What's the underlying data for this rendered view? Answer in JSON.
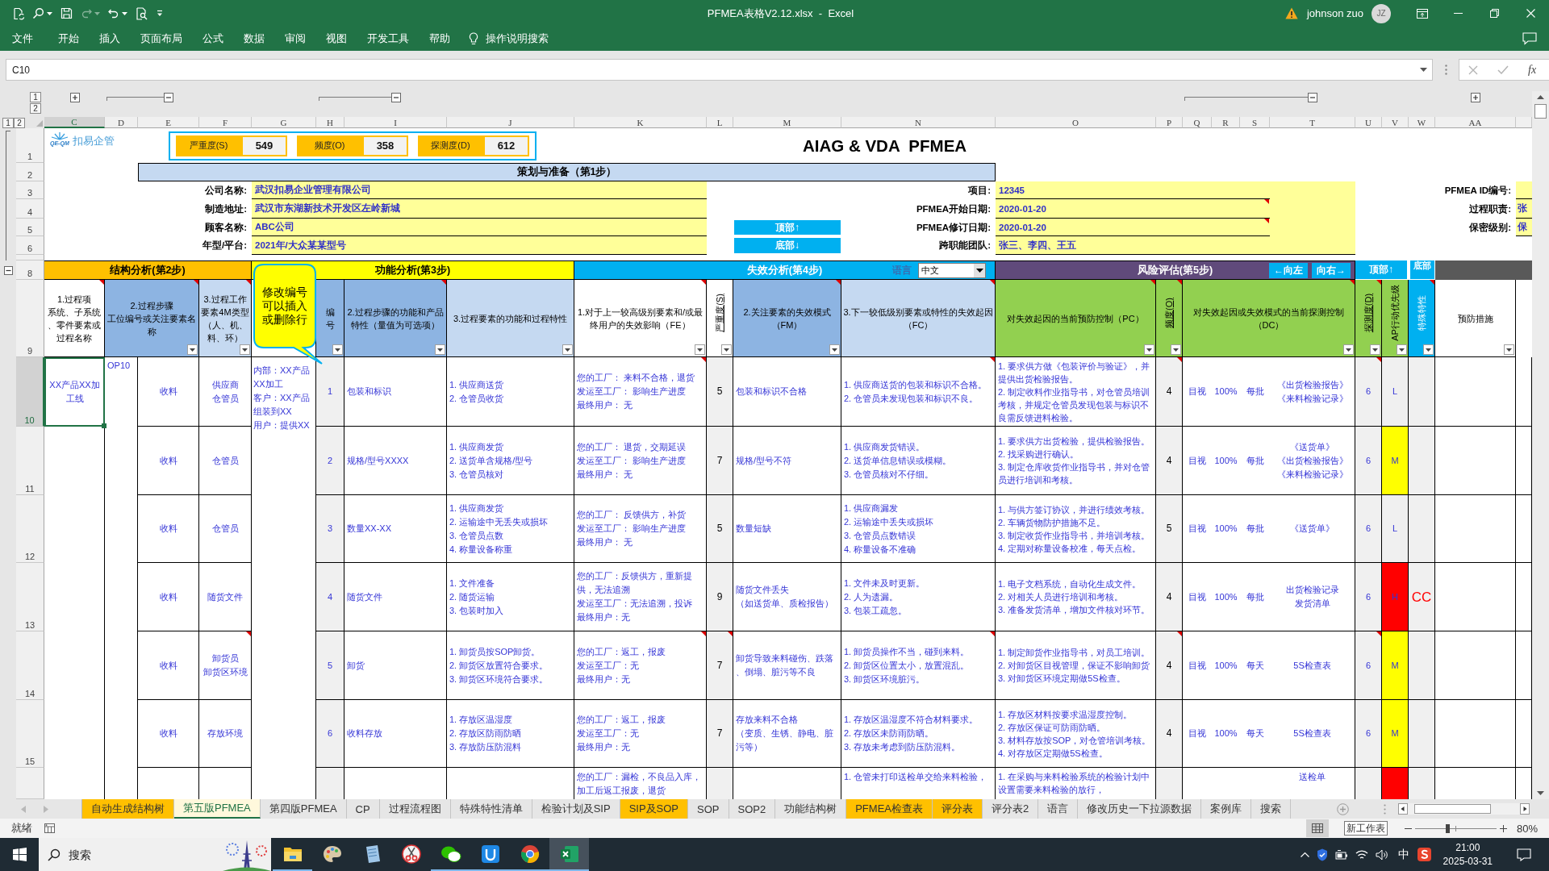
{
  "title_bar": {
    "title": "PFMEA表格V2.12.xlsx  -  Excel",
    "user": "johnson zuo",
    "avatar": "JZ"
  },
  "menu": {
    "items": [
      "文件",
      "开始",
      "插入",
      "页面布局",
      "公式",
      "数据",
      "审阅",
      "视图",
      "开发工具",
      "帮助"
    ],
    "tell_me": "操作说明搜索"
  },
  "formula_bar": {
    "name_box": "C10",
    "function_label": "fx"
  },
  "outline": {
    "column_levels": [
      "1",
      "2"
    ],
    "row_levels": [
      "1",
      "2"
    ]
  },
  "column_headers": [
    {
      "label": "C",
      "selected": true
    },
    {
      "label": "D",
      "selected": false
    },
    {
      "label": "E",
      "selected": false
    },
    {
      "label": "F",
      "selected": false
    },
    {
      "label": "G",
      "selected": false
    },
    {
      "label": "H",
      "selected": false
    },
    {
      "label": "I",
      "selected": false
    },
    {
      "label": "J",
      "selected": false
    },
    {
      "label": "K",
      "selected": false
    },
    {
      "label": "L",
      "selected": false
    },
    {
      "label": "M",
      "selected": false
    },
    {
      "label": "N",
      "selected": false
    },
    {
      "label": "O",
      "selected": false
    },
    {
      "label": "P",
      "selected": false
    },
    {
      "label": "Q",
      "selected": false
    },
    {
      "label": "R",
      "selected": false
    },
    {
      "label": "S",
      "selected": false
    },
    {
      "label": "T",
      "selected": false
    },
    {
      "label": "U",
      "selected": false
    },
    {
      "label": "V",
      "selected": false
    },
    {
      "label": "W",
      "selected": false
    },
    {
      "label": "AA",
      "selected": false
    }
  ],
  "row_headers": [
    {
      "label": "1",
      "selected": false
    },
    {
      "label": "2",
      "selected": false
    },
    {
      "label": "3",
      "selected": false
    },
    {
      "label": "4",
      "selected": false
    },
    {
      "label": "5",
      "selected": false
    },
    {
      "label": "6",
      "selected": false
    },
    {
      "label": "8",
      "selected": false
    },
    {
      "label": "9",
      "selected": false
    },
    {
      "label": "10",
      "selected": true
    },
    {
      "label": "11",
      "selected": false
    },
    {
      "label": "12",
      "selected": false
    },
    {
      "label": "13",
      "selected": false
    },
    {
      "label": "14",
      "selected": false
    },
    {
      "label": "15",
      "selected": false
    }
  ],
  "sheet": {
    "logo": {
      "subtext": "QE-QM",
      "text": "扣易企管"
    },
    "scores": [
      {
        "label": "严重度(S)",
        "value": "549"
      },
      {
        "label": "频度(O)",
        "value": "358"
      },
      {
        "label": "探测度(D)",
        "value": "612"
      }
    ],
    "title": "AIAG & VDA  PFMEA",
    "planning_title": "策划与准备（第1步）",
    "left_fields": [
      {
        "label": "公司名称:",
        "value": "武汉扣易企业管理有限公司"
      },
      {
        "label": "制造地址:",
        "value": "武汉市东湖新技术开发区左岭新城"
      },
      {
        "label": "顾客名称:",
        "value": "ABC公司"
      },
      {
        "label": "年型/平台:",
        "value": "2021年/大众某某型号"
      }
    ],
    "jump_buttons": [
      "顶部↑",
      "底部↓"
    ],
    "right_fields": [
      {
        "label": "项目:",
        "value": "12345",
        "comment": false
      },
      {
        "label": "PFMEA开始日期:",
        "value": "2020-01-20",
        "comment": true
      },
      {
        "label": "PFMEA修订日期:",
        "value": "2020-01-20",
        "comment": true
      },
      {
        "label": "跨职能团队:",
        "value": "张三、李四、王五",
        "comment": false
      }
    ],
    "far_right_fields": [
      {
        "label": "PFMEA ID编号:"
      },
      {
        "label": "过程职责:",
        "value": "张"
      },
      {
        "label": "保密级别:",
        "value": "保"
      }
    ],
    "sections": [
      {
        "title": "结构分析(第2步)",
        "color": "#ffc000"
      },
      {
        "title": "功能分析(第3步)",
        "color": "#ffff00"
      },
      {
        "title": "失效分析(第4步)",
        "color": "#00b0f0"
      },
      {
        "title": "风险评估(第5步)",
        "color": "#604a7b"
      }
    ],
    "language": {
      "label": "语言",
      "value": "中文"
    },
    "nav_buttons": [
      "←向左",
      "向右→",
      "顶部↑",
      "底部"
    ],
    "callout": "修改编号可以插入或删除行",
    "headers": [
      {
        "lines": [
          "1.过程项",
          "系统、子系统",
          "、零件要素或",
          "过程名称"
        ],
        "kind": "horizontal",
        "color": "#ffffff",
        "filter": false,
        "comment": true
      },
      {
        "lines": [
          "2.过程步骤",
          "工位编号或关注要素名",
          "称"
        ],
        "kind": "horizontal",
        "color": "#8db4e2",
        "filter": true,
        "comment": true
      },
      {
        "lines": [
          "3.过程工作",
          "要素4M类型",
          "（人、机、",
          "料、环）"
        ],
        "kind": "horizontal",
        "color": "#c5d9f1",
        "filter": true,
        "comment": true
      },
      {
        "lines": [
          "编",
          "号"
        ],
        "kind": "horizontal",
        "color": "#8db4e2",
        "filter": true,
        "comment": false
      },
      {
        "lines": [
          "2.过程步骤的功能和产品",
          "特性（量值为可选项）"
        ],
        "kind": "horizontal",
        "color": "#8db4e2",
        "filter": true,
        "comment": true
      },
      {
        "lines": [
          "3.过程要素的功能和过程特性"
        ],
        "kind": "horizontal",
        "color": "#c5d9f1",
        "filter": true,
        "comment": false
      },
      {
        "lines": [
          "1.对于上一较高级别要素和/或最",
          "终用户的失效影响（FE）"
        ],
        "kind": "horizontal",
        "color": "#ffffff",
        "filter": true,
        "comment": true
      },
      {
        "lines": [
          "严重度(S)"
        ],
        "kind": "vertical",
        "underline": true,
        "color": "#ffffff",
        "filter": true,
        "comment": false
      },
      {
        "lines": [
          "2.关注要素的失效模式",
          "（FM）"
        ],
        "kind": "horizontal",
        "color": "#8db4e2",
        "filter": true,
        "comment": true
      },
      {
        "lines": [
          "3.下一较低级别要素或特性的失效起因",
          "（FC）"
        ],
        "kind": "horizontal",
        "color": "#c5d9f1",
        "filter": false,
        "comment": true
      },
      {
        "lines": [
          "对失效起因的当前预防控制（PC）"
        ],
        "kind": "horizontal",
        "color": "#92d050",
        "filter": true,
        "comment": true
      },
      {
        "lines": [
          "频度(O)"
        ],
        "kind": "vertical",
        "underline": true,
        "color": "#92d050",
        "filter": true,
        "comment": true
      },
      {
        "lines": [
          "对失效起因或失效模式的当前探测控制",
          "（DC）"
        ],
        "kind": "horizontal",
        "color": "#92d050",
        "filter": true,
        "comment": true
      },
      {
        "lines": [
          "探测度(D)"
        ],
        "kind": "vertical",
        "underline": true,
        "color": "#92d050",
        "filter": true,
        "comment": true
      },
      {
        "lines": [
          "AP行动优先级"
        ],
        "kind": "vertical",
        "underline": false,
        "color": "#92d050",
        "filter": true,
        "comment": false
      },
      {
        "lines": [
          "特殊特性"
        ],
        "kind": "vertical",
        "underline": false,
        "color": "#00b0f0",
        "filter": true,
        "comment": true
      },
      {
        "lines": [
          "预防措施"
        ],
        "kind": "horizontal",
        "color": "#ffffff",
        "filter": true,
        "comment": false
      }
    ],
    "structure": {
      "item": "XX产品XX加工线",
      "selected": true,
      "step": "OP10",
      "notes": [
        "内部：XX产品XX加工",
        "客户：XX产品组装到XX",
        "用户：提供XX"
      ]
    },
    "rows": [
      {
        "kind": "full",
        "process": "收料",
        "element": [
          "供应商",
          "仓管员"
        ],
        "no": "1",
        "function": "包装和标识",
        "characteristics": [
          "1. 供应商送货",
          "2. 仓管员收货"
        ],
        "effects": [
          "您的工厂： 来料不合格，退货",
          "发运至工厂： 影响生产进度",
          "最终用户： 无"
        ],
        "severity": "5",
        "failure_mode": [
          "包装和标识不合格"
        ],
        "causes": [
          "1. 供应商送货的包装和标识不合格。",
          "2. 仓管员未发现包装和标识不良。"
        ],
        "prevention": [
          "1. 要求供方做《包装评价与验证》，并提供出货检验报告。",
          "2. 制定收料作业指导书，对仓管员培训考核，并规定仓管员发现包装与标识不良需反馈进料检验。"
        ],
        "occurrence": "4",
        "method": "目视",
        "sample": "100%",
        "frequency": "每批",
        "controls": [
          "《出货检验报告》",
          "《来料检验记录》"
        ],
        "detection": "6",
        "ap": {
          "text": "L",
          "color": "#f0f0f0"
        },
        "comment_on": {
          "effects": true,
          "causes": true,
          "occurrence": true,
          "detection": true
        }
      },
      {
        "kind": "full",
        "process": "收料",
        "element": [
          "仓管员"
        ],
        "no": "2",
        "function": "规格/型号XXXX",
        "characteristics": [
          "1. 供应商发货",
          "2. 送货单含规格/型号",
          "3. 仓管员核对"
        ],
        "effects": [
          "您的工厂： 退货，交期延误",
          "发运至工厂： 影响生产进度",
          "最终用户： 无"
        ],
        "severity": "7",
        "failure_mode": [
          "规格/型号不符"
        ],
        "causes": [
          "1. 供应商发货错误。",
          "2. 送货单信息错误或模糊。",
          "3. 仓管员核对不仔细。"
        ],
        "prevention": [
          "1. 要求供方出货检验，提供检验报告。",
          "2. 找采购进行确认。",
          "3. 制定仓库收货作业指导书，并对仓管员进行培训和考核。"
        ],
        "occurrence": "4",
        "method": "目视",
        "sample": "100%",
        "frequency": "每批",
        "controls": [
          "《送货单》",
          "《出货检验报告》",
          "《来料检验记录》"
        ],
        "detection": "6",
        "ap": {
          "text": "M",
          "color": "#ffff00"
        }
      },
      {
        "kind": "full",
        "process": "收料",
        "element": [
          "仓管员"
        ],
        "no": "3",
        "function": "数量XX-XX",
        "characteristics": [
          "1. 供应商发货",
          "2. 运输途中无丢失或损坏",
          "3. 仓管员点数",
          "4. 称量设备称重"
        ],
        "effects": [
          "您的工厂： 反馈供方，补货",
          "发运至工厂： 影响生产进度",
          "最终用户： 无"
        ],
        "severity": "5",
        "failure_mode": [
          "数量短缺"
        ],
        "causes": [
          "1. 供应商漏发",
          "2. 运输途中丢失或损坏",
          "3. 仓管员点数错误",
          "4. 称量设备不准确"
        ],
        "prevention": [
          "1. 与供方签订协议，并进行绩效考核。",
          "2. 车辆货物防护措施不足。",
          "3. 制定收货作业指导书，并培训考核。",
          "4. 定期对称量设备校准，每天点检。"
        ],
        "occurrence": "5",
        "method": "目视",
        "sample": "100%",
        "frequency": "每批",
        "controls": [
          "《送货单》"
        ],
        "detection": "6",
        "ap": {
          "text": "L",
          "color": "#f0f0f0"
        }
      },
      {
        "kind": "full",
        "process": "收料",
        "element": [
          "随货文件"
        ],
        "no": "4",
        "function": "随货文件",
        "characteristics": [
          "1. 文件准备",
          "2. 随货运输",
          "3. 包装时加入"
        ],
        "effects": [
          "您的工厂：反馈供方，重新提供，无法追溯",
          "发运至工厂：无法追溯，投诉",
          "最终用户：无"
        ],
        "severity": "9",
        "failure_mode": [
          "随货文件丢失",
          "（如送货单、质检报告）"
        ],
        "causes": [
          "1. 文件未及时更新。",
          "2. 人为遗漏。",
          "3. 包装工疏忽。"
        ],
        "prevention": [
          "1. 电子文档系统，自动化生成文件。",
          "2. 对相关人员进行培训和考核。",
          "3. 准备发货清单，增加文件核对环节。"
        ],
        "occurrence": "4",
        "method": "目视",
        "sample": "100%",
        "frequency": "每批",
        "controls": [
          "出货检验记录",
          "发货清单"
        ],
        "detection": "6",
        "ap": {
          "text": "H",
          "color": "#ff0000"
        },
        "special": "CC"
      },
      {
        "kind": "full",
        "process": "收料",
        "element": [
          "卸货员",
          "卸货区环境"
        ],
        "no": "5",
        "function": "卸货",
        "characteristics": [
          "1. 卸货员按SOP卸货。",
          "2. 卸货区放置符合要求。",
          "3. 卸货区环境符合要求。"
        ],
        "effects": [
          "您的工厂：返工，报废",
          "发运至工厂：无",
          "最终用户：无"
        ],
        "severity": "7",
        "failure_mode": [
          "卸货导致来料碰伤、跌落、倒塌、脏污等不良"
        ],
        "causes": [
          "1. 卸货员操作不当，碰到来料。",
          "2. 卸货区位置太小，放置混乱。",
          "3. 卸货区环境脏污。"
        ],
        "prevention": [
          "1. 制定卸货作业指导书，对员工培训。",
          "2. 对卸货区目视管理，保证不影响卸货",
          "3. 对卸货区环境定期做5S检查。"
        ],
        "occurrence": "4",
        "method": "目视",
        "sample": "100%",
        "frequency": "每天",
        "controls": [
          "5S检查表"
        ],
        "detection": "6",
        "ap": {
          "text": "M",
          "color": "#ffff00"
        },
        "comment_on": {
          "element": true,
          "effects": true,
          "severity": true,
          "causes": true,
          "occurrence": true,
          "detection": true
        }
      },
      {
        "kind": "full",
        "process": "收料",
        "element": [
          "存放环境"
        ],
        "no": "6",
        "function": "收料存放",
        "characteristics": [
          "1. 存放区温湿度",
          "2. 存放区防雨防晒",
          "3. 存放防压防混料"
        ],
        "effects": [
          "您的工厂：返工，报废",
          "发运至工厂：无",
          "最终用户：无"
        ],
        "severity": "7",
        "failure_mode": [
          "存放来料不合格",
          "（变质、生锈、静电、脏污等）"
        ],
        "causes": [
          "1. 存放区温湿度不符合材料要求。",
          "2. 存放区未防雨防晒。",
          "3. 存放未考虑到防压防混料。"
        ],
        "prevention": [
          "1. 存放区材料按要求温湿度控制。",
          "2. 存放区保证可防雨防晒。",
          "3. 材料存放按SOP，对仓管培训考核。",
          "4. 对存放区定期做5S检查。"
        ],
        "occurrence": "4",
        "method": "目视",
        "sample": "100%",
        "frequency": "每天",
        "controls": [
          "5S检查表"
        ],
        "detection": "6",
        "ap": {
          "text": "M",
          "color": "#ffff00"
        }
      },
      {
        "kind": "partial",
        "effects": [
          "您的工厂：漏检，不良品入库，",
          "加工后返工报废，退货"
        ],
        "causes": [
          "1. 仓管未打印送检单交给来料检验，"
        ],
        "prevention": [
          "1. 在采购与来料检验系统的检验计划中设置需要来料检验的放行，"
        ],
        "controls": [
          "送检单"
        ],
        "ap": {
          "color": "#ff0000"
        }
      }
    ]
  },
  "sheet_tabs": [
    {
      "label": "自动生成结构树",
      "selected": false,
      "color": "#ffc000"
    },
    {
      "label": "第五版PFMEA",
      "selected": true
    },
    {
      "label": "第四版PFMEA",
      "selected": false
    },
    {
      "label": "CP",
      "selected": false
    },
    {
      "label": "过程流程图",
      "selected": false
    },
    {
      "label": "特殊特性清单",
      "selected": false
    },
    {
      "label": "检验计划及SIP",
      "selected": false
    },
    {
      "label": "SIP及SOP",
      "selected": false,
      "color": "#ffc000"
    },
    {
      "label": "SOP",
      "selected": false
    },
    {
      "label": "SOP2",
      "selected": false
    },
    {
      "label": "功能结构树",
      "selected": false
    },
    {
      "label": "PFMEA检查表",
      "selected": false,
      "color": "#ffc000"
    },
    {
      "label": "评分表",
      "selected": false,
      "color": "#ffc000"
    },
    {
      "label": "评分表2",
      "selected": false
    },
    {
      "label": "语言",
      "selected": false
    },
    {
      "label": "修改历史一下拉源数据",
      "selected": false
    },
    {
      "label": "案例库",
      "selected": false
    },
    {
      "label": "搜索",
      "selected": false
    }
  ],
  "status_bar": {
    "status": "就绪",
    "tooltip": "新工作表",
    "zoom": "80%",
    "level": 0.4
  },
  "taskbar": {
    "search": {
      "placeholder": "搜索"
    },
    "apps": [
      {
        "running": true,
        "selected": false
      },
      {
        "running": false,
        "selected": false
      },
      {
        "running": false,
        "selected": false
      },
      {
        "running": false,
        "selected": false
      },
      {
        "running": true,
        "selected": false
      },
      {
        "running": true,
        "selected": false
      },
      {
        "running": true,
        "selected": false
      },
      {
        "running": true,
        "selected": true
      }
    ],
    "ime": "中",
    "time": "21:00",
    "date": "2025-03-31"
  }
}
